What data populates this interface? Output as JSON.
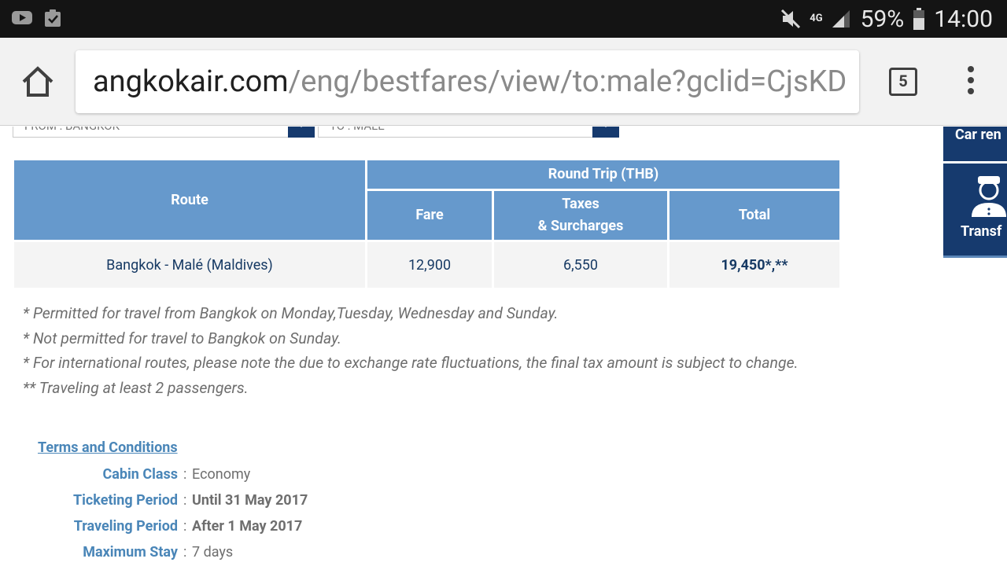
{
  "status_bar": {
    "network": "4G",
    "battery_percent": "59%",
    "time": "14:00",
    "icons": [
      "youtube-icon",
      "clipboard-check-icon",
      "mute-icon",
      "signal-icon",
      "battery-icon"
    ]
  },
  "browser": {
    "url_host": "angkokair.com",
    "url_path": "/eng/bestfares/view/to:male?gclid=CjsKD",
    "tab_count": "5"
  },
  "filters": {
    "from": "FROM : BANGKOK",
    "to": "TO : MALE"
  },
  "table": {
    "header_route": "Route",
    "header_round_trip": "Round Trip (THB)",
    "header_fare": "Fare",
    "header_taxes_line1": "Taxes",
    "header_taxes_line2": "& Surcharges",
    "header_total": "Total",
    "rows": [
      {
        "route": "Bangkok - Malé (Maldives)",
        "fare": "12,900",
        "taxes": "6,550",
        "total": "19,450*,**"
      }
    ]
  },
  "notes": [
    "* Permitted for travel from Bangkok on Monday,Tuesday, Wednesday and Sunday.",
    "* Not permitted for travel to Bangkok on Sunday.",
    "* For international routes, please note the due to exchange rate fluctuations, the final tax amount is subject to change.",
    "** Traveling at least 2 passengers."
  ],
  "terms": {
    "link": "Terms and Conditions",
    "separator": ":",
    "cabin_class_label": "Cabin Class",
    "cabin_class_value": "Economy",
    "ticketing_period_label": "Ticketing Period",
    "ticketing_period_value": "Until 31 May 2017",
    "traveling_period_label": "Traveling Period",
    "traveling_period_value": "After 1 May 2017",
    "maximum_stay_label": "Maximum Stay",
    "maximum_stay_value": "7 days"
  },
  "side_panel": {
    "car_rental": "Car ren",
    "transfer": "Transf"
  },
  "colors": {
    "table_header": "#6699cc",
    "navy": "#163a6e",
    "link_blue": "#4a86b8"
  }
}
